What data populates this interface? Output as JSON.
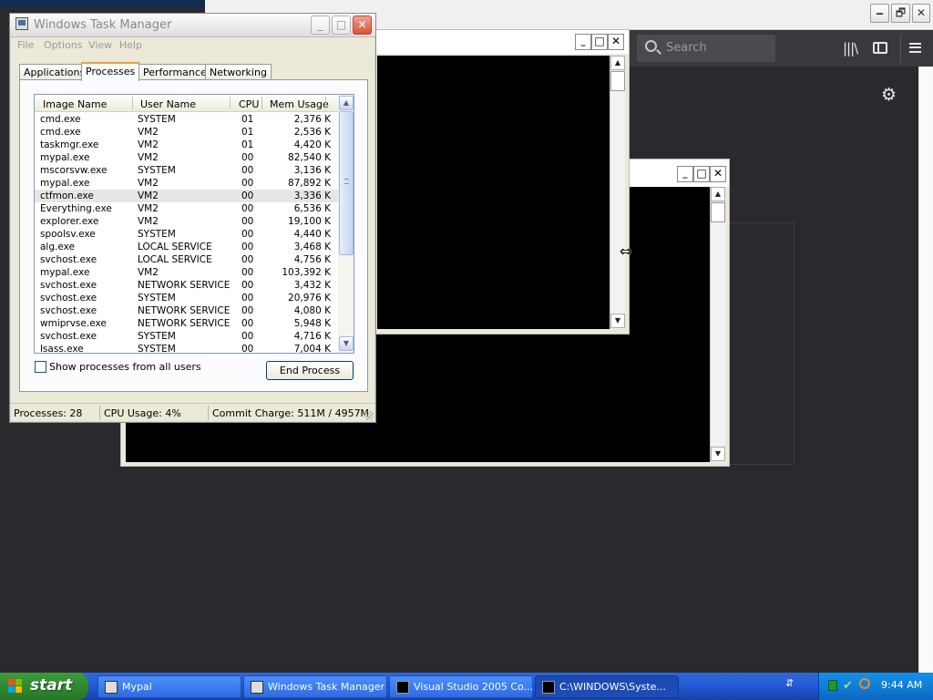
{
  "browser": {
    "search_placeholder": "Search",
    "minimize": "🗕",
    "restore": "🗗",
    "library_icon": "library-icon",
    "sidebar_icon": "sidebar-icon",
    "menu_icon": "hamburger-menu-icon",
    "settings_icon": "gear-icon"
  },
  "task_manager": {
    "title": "Windows Task Manager",
    "menu": [
      "File",
      "Options",
      "View",
      "Help"
    ],
    "tabs": [
      "Applications",
      "Processes",
      "Performance",
      "Networking"
    ],
    "active_tab": "Processes",
    "columns": [
      "Image Name",
      "User Name",
      "CPU",
      "Mem Usage"
    ],
    "rows": [
      [
        "cmd.exe",
        "SYSTEM",
        "01",
        "2,376 K"
      ],
      [
        "cmd.exe",
        "VM2",
        "01",
        "2,536 K"
      ],
      [
        "taskmgr.exe",
        "VM2",
        "01",
        "4,420 K"
      ],
      [
        "mypal.exe",
        "VM2",
        "00",
        "82,540 K"
      ],
      [
        "mscorsvw.exe",
        "SYSTEM",
        "00",
        "3,136 K"
      ],
      [
        "mypal.exe",
        "VM2",
        "00",
        "87,892 K"
      ],
      [
        "ctfmon.exe",
        "VM2",
        "00",
        "3,336 K"
      ],
      [
        "Everything.exe",
        "VM2",
        "00",
        "6,536 K"
      ],
      [
        "explorer.exe",
        "VM2",
        "00",
        "19,100 K"
      ],
      [
        "spoolsv.exe",
        "SYSTEM",
        "00",
        "4,440 K"
      ],
      [
        "alg.exe",
        "LOCAL SERVICE",
        "00",
        "3,468 K"
      ],
      [
        "svchost.exe",
        "LOCAL SERVICE",
        "00",
        "4,756 K"
      ],
      [
        "mypal.exe",
        "VM2",
        "00",
        "103,392 K"
      ],
      [
        "svchost.exe",
        "NETWORK SERVICE",
        "00",
        "3,432 K"
      ],
      [
        "svchost.exe",
        "SYSTEM",
        "00",
        "20,976 K"
      ],
      [
        "svchost.exe",
        "NETWORK SERVICE",
        "00",
        "4,080 K"
      ],
      [
        "wmiprvse.exe",
        "NETWORK SERVICE",
        "00",
        "5,948 K"
      ],
      [
        "svchost.exe",
        "SYSTEM",
        "00",
        "4,716 K"
      ],
      [
        "lsass.exe",
        "SYSTEM",
        "00",
        "7,004 K"
      ]
    ],
    "selected_row": 6,
    "show_all_label": "Show processes from all users",
    "show_all_checked": false,
    "end_process": "End Process",
    "status_processes": "Processes: 28",
    "status_cpu": "CPU Usage: 4%",
    "status_commit": "Commit Charge: 511M / 4957M"
  },
  "taskbar": {
    "start": "start",
    "items": [
      {
        "label": "Mypal",
        "active": false
      },
      {
        "label": "Windows Task Manager",
        "active": false
      },
      {
        "label": "Visual Studio 2005 Co...",
        "active": false
      },
      {
        "label": "C:\\WINDOWS\\Syste...",
        "active": true
      }
    ],
    "clock": "9:44 AM"
  },
  "colors": {
    "taskbar_blue": "#245edb",
    "start_green": "#2f8a2f",
    "tray_blue": "#0f7fd8",
    "browser_dark": "#2a2a2e"
  }
}
